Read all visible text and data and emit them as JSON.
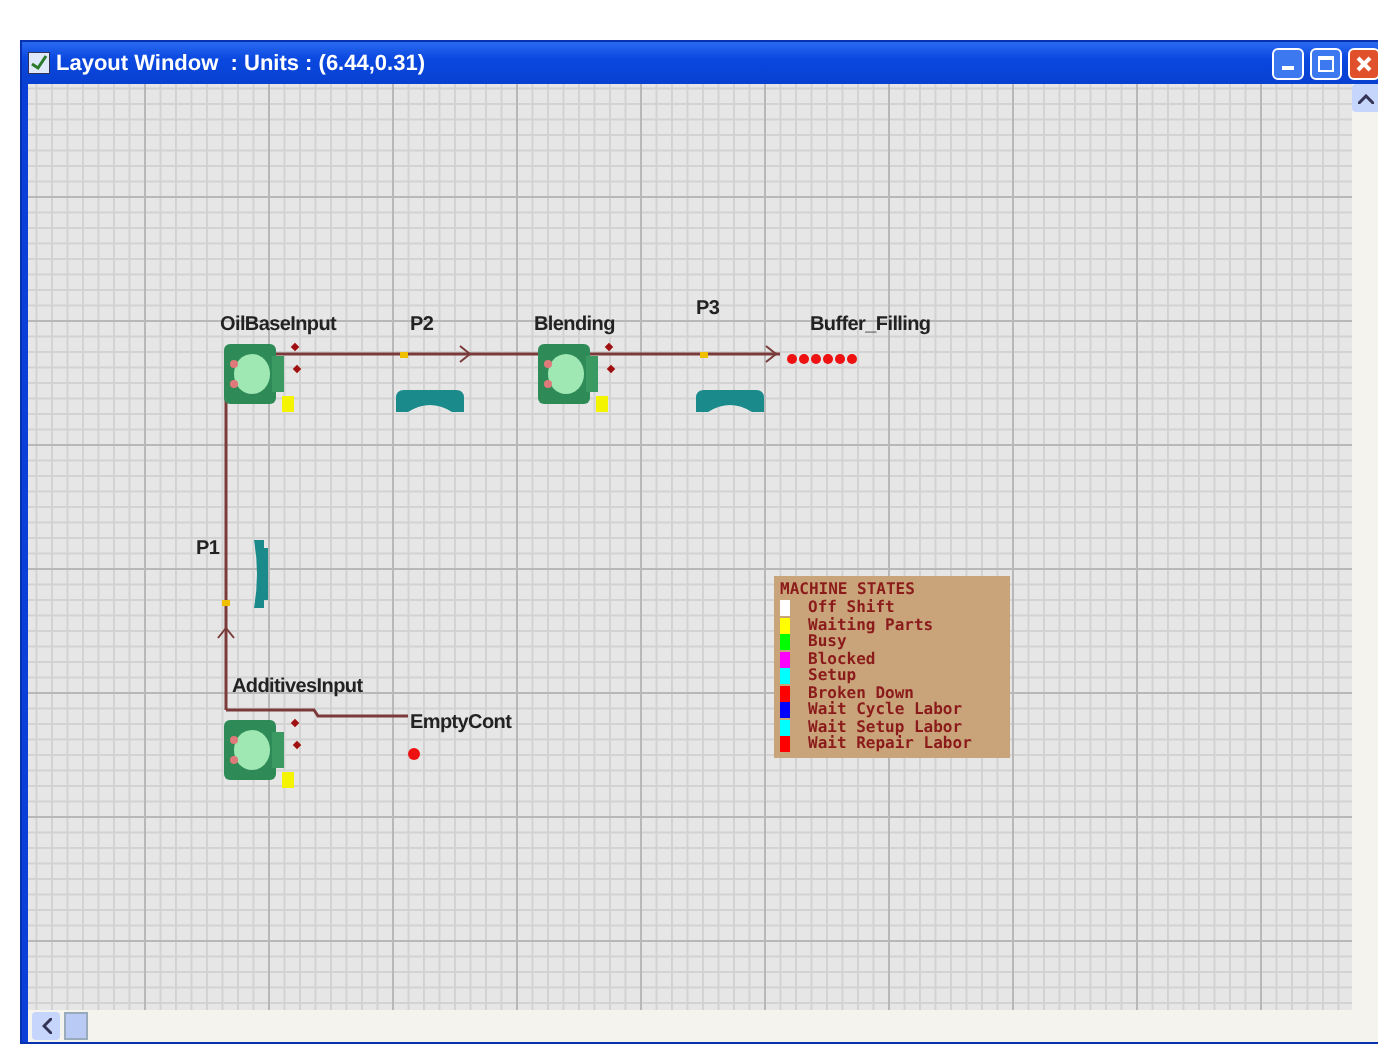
{
  "window": {
    "title": "Layout Window  : Units : (6.44,0.31)"
  },
  "nodes": [
    {
      "kind": "machine",
      "label": "OilBaseInput"
    },
    {
      "kind": "path",
      "label": "P2"
    },
    {
      "kind": "machine",
      "label": "Blending"
    },
    {
      "kind": "path",
      "label": "P3"
    },
    {
      "kind": "buffer",
      "label": "Buffer_Filling"
    },
    {
      "kind": "path",
      "label": "P1"
    },
    {
      "kind": "machine",
      "label": "AdditivesInput"
    },
    {
      "kind": "sink",
      "label": "EmptyCont"
    }
  ],
  "legend": {
    "title": "MACHINE STATES",
    "states": [
      {
        "label": "Off Shift",
        "color": "#ffffff"
      },
      {
        "label": "Waiting Parts",
        "color": "#ffff00"
      },
      {
        "label": "Busy",
        "color": "#00ff00"
      },
      {
        "label": "Blocked",
        "color": "#ff00ff"
      },
      {
        "label": "Setup",
        "color": "#00ffff"
      },
      {
        "label": "Broken Down",
        "color": "#ff0000"
      },
      {
        "label": "Wait Cycle Labor",
        "color": "#0000ff"
      },
      {
        "label": "Wait Setup Labor",
        "color": "#00ffff"
      },
      {
        "label": "Wait Repair Labor",
        "color": "#ff0000"
      }
    ]
  }
}
